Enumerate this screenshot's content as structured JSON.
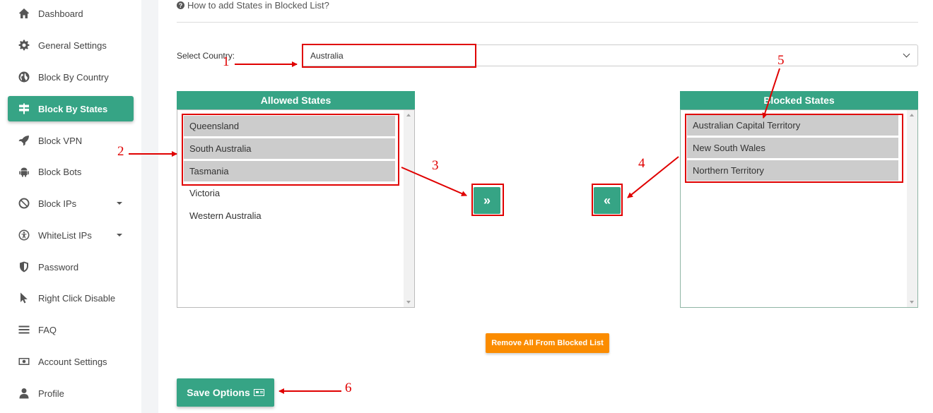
{
  "sidebar": {
    "items": [
      {
        "label": "Dashboard",
        "icon": "home-icon"
      },
      {
        "label": "General Settings",
        "icon": "gear-icon"
      },
      {
        "label": "Block By Country",
        "icon": "globe-icon"
      },
      {
        "label": "Block By States",
        "icon": "signpost-icon",
        "active": true
      },
      {
        "label": "Block VPN",
        "icon": "rocket-icon"
      },
      {
        "label": "Block Bots",
        "icon": "android-icon"
      },
      {
        "label": "Block IPs",
        "icon": "ban-icon",
        "has_dropdown": true
      },
      {
        "label": "WhiteList IPs",
        "icon": "accessibility-icon",
        "has_dropdown": true
      },
      {
        "label": "Password",
        "icon": "shield-icon"
      },
      {
        "label": "Right Click Disable",
        "icon": "pointer-icon"
      },
      {
        "label": "FAQ",
        "icon": "menu-icon"
      },
      {
        "label": "Account Settings",
        "icon": "money-icon"
      },
      {
        "label": "Profile",
        "icon": "user-icon"
      }
    ]
  },
  "main": {
    "help_link": "How to add States in Blocked List?",
    "country_label": "Select Country:",
    "country_value": "Australia",
    "allowed": {
      "title": "Allowed States",
      "options": [
        {
          "label": "Queensland",
          "selected": true
        },
        {
          "label": "South Australia",
          "selected": true
        },
        {
          "label": "Tasmania",
          "selected": true
        },
        {
          "label": "Victoria",
          "selected": false
        },
        {
          "label": "Western Australia",
          "selected": false
        }
      ]
    },
    "blocked": {
      "title": "Blocked States",
      "options": [
        {
          "label": "Australian Capital Territory",
          "selected": true
        },
        {
          "label": "New South Wales",
          "selected": true
        },
        {
          "label": "Northern Territory",
          "selected": true
        }
      ]
    },
    "move_to_blocked_glyph": "»",
    "move_to_allowed_glyph": "«",
    "remove_all_label": "Remove All From Blocked List",
    "save_label": "Save Options"
  },
  "annotations": {
    "numbers": [
      "1",
      "2",
      "3",
      "4",
      "5",
      "6"
    ],
    "color": "#e00000"
  },
  "colors": {
    "accent": "#36a485",
    "warning": "#fb8c00",
    "selected_option": "#cccccc",
    "annotation": "#e00000"
  }
}
